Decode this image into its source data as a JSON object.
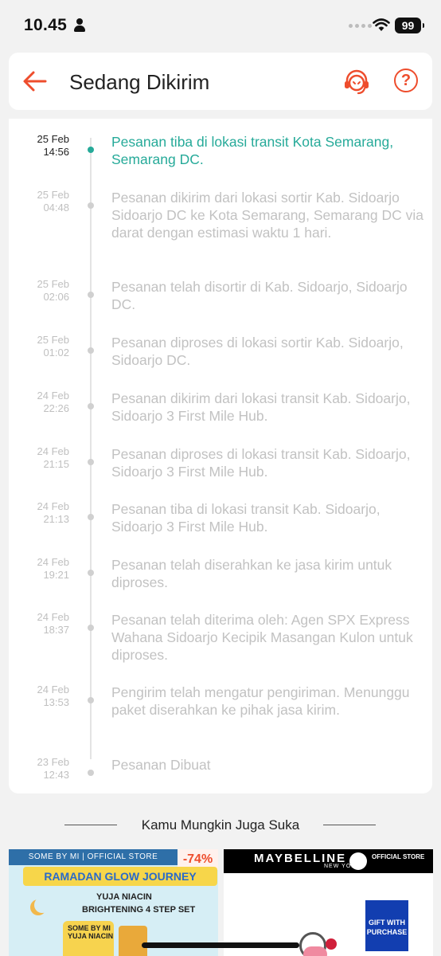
{
  "status_bar": {
    "time": "10.45",
    "battery": "99"
  },
  "header": {
    "title": "Sedang Dikirim"
  },
  "timeline": [
    {
      "date": "25 Feb",
      "time": "14:56",
      "text": "Pesanan tiba di lokasi transit Kota Semarang, Semarang DC.",
      "active": true
    },
    {
      "date": "25 Feb",
      "time": "04:48",
      "text": "Pesanan dikirim dari lokasi sortir Kab. Sidoarjo  Sidoarjo DC ke Kota Semarang, Semarang DC via darat dengan estimasi waktu 1 hari.",
      "active": false
    },
    {
      "date": "25 Feb",
      "time": "02:06",
      "text": "Pesanan telah disortir di Kab. Sidoarjo, Sidoarjo DC.",
      "active": false
    },
    {
      "date": "25 Feb",
      "time": "01:02",
      "text": "Pesanan diproses di lokasi sortir Kab. Sidoarjo, Sidoarjo DC.",
      "active": false
    },
    {
      "date": "24 Feb",
      "time": "22:26",
      "text": "Pesanan dikirim dari lokasi transit Kab. Sidoarjo, Sidoarjo 3 First Mile Hub.",
      "active": false
    },
    {
      "date": "24 Feb",
      "time": "21:15",
      "text": "Pesanan diproses di lokasi transit Kab. Sidoarjo, Sidoarjo 3 First Mile Hub.",
      "active": false
    },
    {
      "date": "24 Feb",
      "time": "21:13",
      "text": "Pesanan tiba di lokasi transit Kab. Sidoarjo, Sidoarjo 3 First Mile Hub.",
      "active": false
    },
    {
      "date": "24 Feb",
      "time": "19:21",
      "text": "Pesanan telah diserahkan ke jasa kirim untuk diproses.",
      "active": false
    },
    {
      "date": "24 Feb",
      "time": "18:37",
      "text": "Pesanan telah diterima oleh: Agen SPX Express Wahana Sidoarjo Kecipik Masangan Kulon untuk diproses.",
      "active": false
    },
    {
      "date": "24 Feb",
      "time": "13:53",
      "text": "Pengirim telah mengatur pengiriman. Menunggu paket diserahkan ke pihak jasa kirim.",
      "active": false
    },
    {
      "date": "23 Feb",
      "time": "12:43",
      "text": "Pesanan Dibuat",
      "active": false
    }
  ],
  "recommendations": {
    "title": "Kamu Mungkin Juga Suka",
    "products": [
      {
        "store": "SOME BY MI  |  OFFICIAL STORE",
        "discount": "-74%",
        "banner": "RAMADAN GLOW JOURNEY",
        "line1": "YUJA NIACIN",
        "line2": "BRIGHTENING 4 STEP SET",
        "bottle_label": "SOME BY MI YUJA NIACIN"
      },
      {
        "brand": "MAYBELLINE",
        "brand_sub": "NEW YORK",
        "official": "OFFICIAL STORE",
        "gift": "GIFT WITH PURCHASE"
      }
    ]
  },
  "colors": {
    "accent": "#ee4d2d",
    "active_green": "#26aa99",
    "inactive_text": "#c2c2c2"
  }
}
